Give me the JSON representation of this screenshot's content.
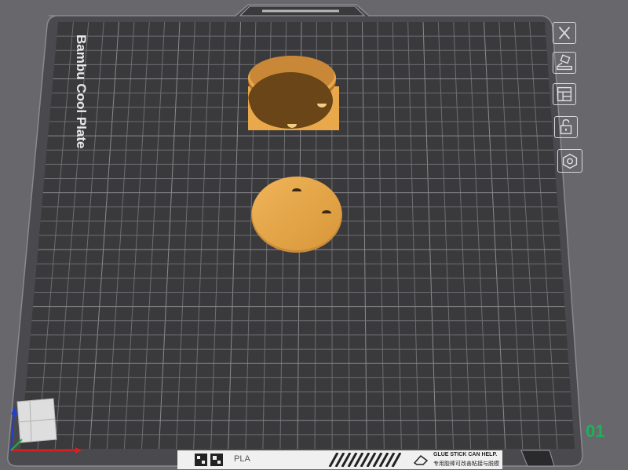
{
  "plate": {
    "name": "Bambu Cool Plate",
    "number": "01",
    "filament_label": "PLA",
    "tip_line1": "GLUE STICK CAN HELP.",
    "tip_line2": "专用胶棒可改善粘接与脱模"
  },
  "toolbar": {
    "icons": [
      "close-icon",
      "auto-orient-icon",
      "arrange-icon",
      "lock-icon",
      "settings-icon"
    ]
  },
  "colors": {
    "background": "#68686c",
    "plate": "#3a3a3c",
    "grid": "#6e6e72",
    "model": "#e9a94a",
    "model_shadow": "#6a4518",
    "accent_number": "#1fb15a"
  },
  "objects": [
    {
      "name": "disc-part-raised",
      "type": "disc"
    },
    {
      "name": "disc-part-flat",
      "type": "disc"
    }
  ]
}
